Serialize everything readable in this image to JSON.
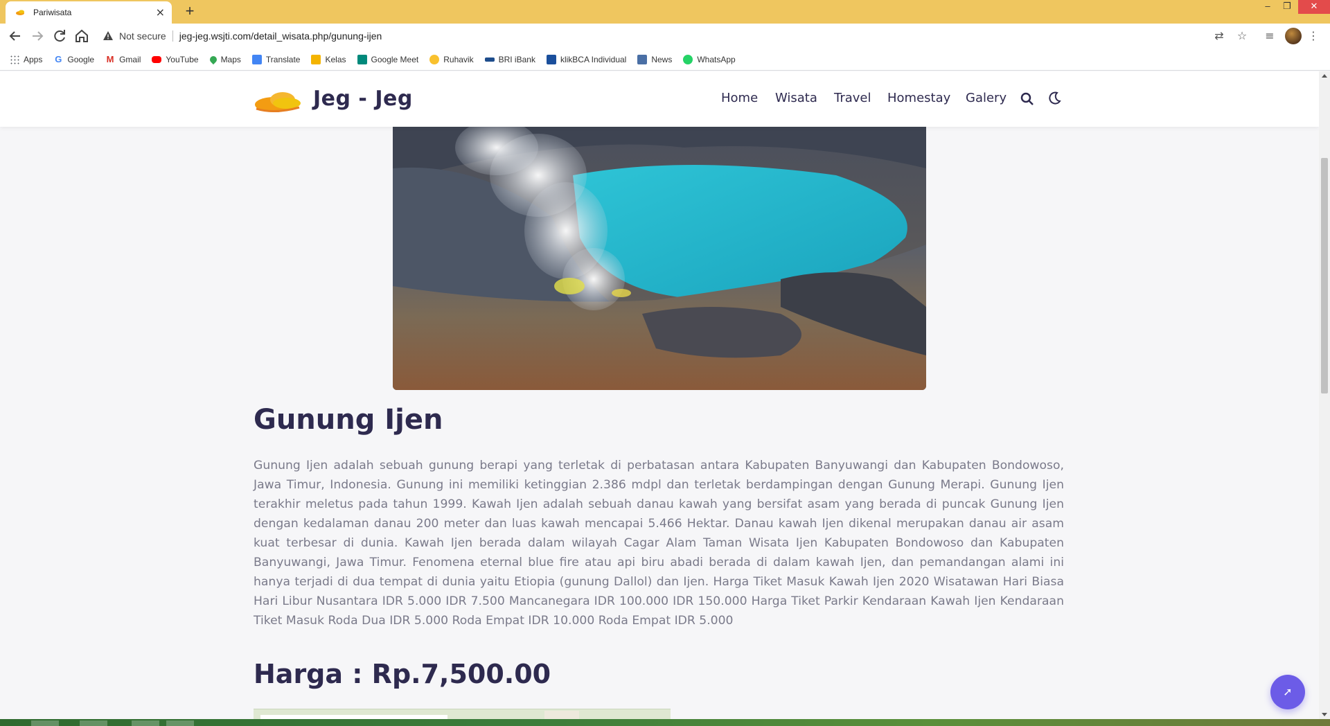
{
  "browser": {
    "tab_title": "Pariwisata",
    "tab_close": "×",
    "new_tab": "+",
    "security_label": "Not secure",
    "url": "jeg-jeg.wsjti.com/detail_wisata.php/gunung-ijen",
    "window_controls": {
      "minimize": "–",
      "restore": "❐",
      "close": "✕"
    }
  },
  "bookmarks": [
    {
      "label": "Apps",
      "icon": "apps-grid-icon",
      "color": "#5f6368"
    },
    {
      "label": "Google",
      "icon": "google-icon",
      "color": "#4285f4"
    },
    {
      "label": "Gmail",
      "icon": "gmail-icon",
      "color": "#d93025"
    },
    {
      "label": "YouTube",
      "icon": "youtube-icon",
      "color": "#ff0000"
    },
    {
      "label": "Maps",
      "icon": "maps-pin-icon",
      "color": "#34a853"
    },
    {
      "label": "Translate",
      "icon": "translate-icon",
      "color": "#4285f4"
    },
    {
      "label": "Kelas",
      "icon": "classroom-icon",
      "color": "#f4b400"
    },
    {
      "label": "Google Meet",
      "icon": "meet-icon",
      "color": "#00897b"
    },
    {
      "label": "Ruhavik",
      "icon": "ruhavik-icon",
      "color": "#f9c12e"
    },
    {
      "label": "BRI iBank",
      "icon": "bri-icon",
      "color": "#1e4d8c"
    },
    {
      "label": "klikBCA Individual",
      "icon": "bca-icon",
      "color": "#1a4f9c"
    },
    {
      "label": "News",
      "icon": "news-icon",
      "color": "#4a6fa5"
    },
    {
      "label": "WhatsApp",
      "icon": "whatsapp-icon",
      "color": "#25d366"
    }
  ],
  "site": {
    "brand": "Jeg - Jeg",
    "nav": [
      {
        "label": "Home"
      },
      {
        "label": "Wisata"
      },
      {
        "label": "Travel"
      },
      {
        "label": "Homestay"
      },
      {
        "label": "Galery"
      }
    ],
    "accent_color": "#6c5ce7",
    "heading_color": "#2e2a4f"
  },
  "detail": {
    "title": "Gunung Ijen",
    "description": "Gunung Ijen adalah sebuah gunung berapi yang terletak di perbatasan antara Kabupaten Banyuwangi dan Kabupaten Bondowoso, Jawa Timur, Indonesia. Gunung ini memiliki ketinggian 2.386 mdpl dan terletak berdampingan dengan Gunung Merapi. Gunung Ijen terakhir meletus pada tahun 1999. Kawah Ijen adalah sebuah  danau  kawah yang bersifat asam yang berada di puncak Gunung Ijen dengan kedalaman danau 200 meter dan luas kawah mencapai 5.466 Hektar. Danau kawah Ijen dikenal merupakan danau air asam kuat terbesar di dunia. Kawah Ijen berada dalam wilayah Cagar Alam Taman Wisata Ijen Kabupaten Bondowoso dan  Kabupaten Banyuwangi,  Jawa Timur. Fenomena eternal  blue fire  atau api biru abadi berada di dalam kawah Ijen, dan pemandangan alami ini hanya terjadi di dua tempat di dunia yaitu  Etiopia  (gunung Dallol) dan Ijen. Harga Tiket Masuk Kawah Ijen 2020 Wisatawan Hari Biasa Hari Libur Nusantara IDR 5.000 IDR 7.500 Mancanegara IDR 100.000 IDR 150.000 Harga Tiket Parkir Kendaraan Kawah Ijen Kendaraan Tiket Masuk Roda Dua IDR 5.000 Roda Empat IDR 10.000 Roda Empat IDR 5.000",
    "price": "Harga : Rp.7,500.00"
  },
  "fab_icon": "back-to-top-icon"
}
